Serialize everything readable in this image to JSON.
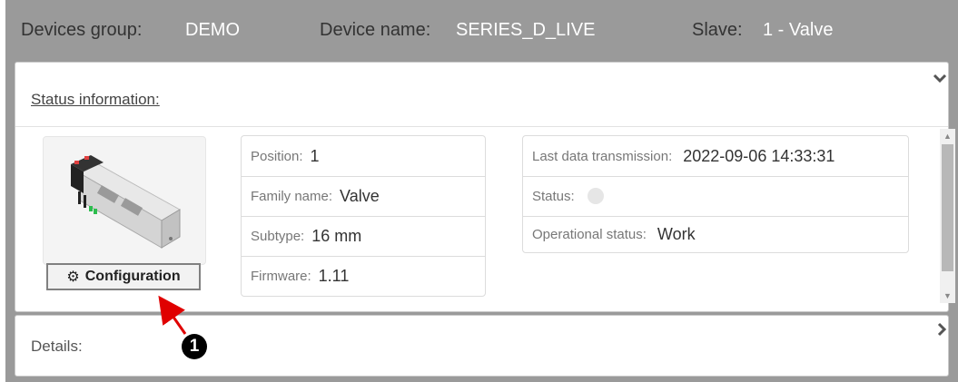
{
  "header": {
    "group_label": "Devices group:",
    "group_value": "DEMO",
    "device_label": "Device name:",
    "device_value": "SERIES_D_LIVE",
    "slave_label": "Slave:",
    "slave_value": "1 - Valve"
  },
  "status_section": {
    "title": "Status information:",
    "configuration_button": "Configuration",
    "left_table": [
      {
        "label": "Position:",
        "value": "1"
      },
      {
        "label": "Family name:",
        "value": "Valve"
      },
      {
        "label": "Subtype:",
        "value": "16 mm"
      },
      {
        "label": "Firmware:",
        "value": "1.11"
      }
    ],
    "right_table": {
      "last_tx_label": "Last data transmission:",
      "last_tx_value": "2022-09-06 14:33:31",
      "status_label": "Status:",
      "operational_label": "Operational status:",
      "operational_value": "Work"
    }
  },
  "details_section": {
    "title": "Details:"
  },
  "annotation": {
    "number": "❶"
  },
  "icons": {
    "collapse": "chevron-down-icon",
    "expand": "chevron-right-icon",
    "configuration": "gear-icon",
    "status": "status-dot-icon"
  },
  "colors": {
    "header_bg": "#9a9a9a",
    "header_value": "#ffffff",
    "annotation_arrow": "#e00000",
    "status_dot": "#e6e6e6"
  }
}
